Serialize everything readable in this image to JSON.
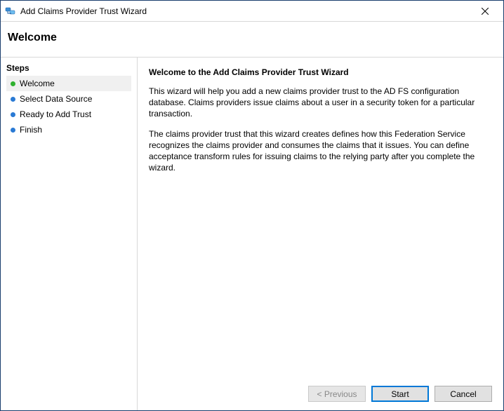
{
  "titlebar": {
    "title": "Add Claims Provider Trust Wizard"
  },
  "page_title": "Welcome",
  "sidebar": {
    "heading": "Steps",
    "items": [
      {
        "label": "Welcome",
        "active": true,
        "bullet": "green"
      },
      {
        "label": "Select Data Source",
        "active": false,
        "bullet": "blue"
      },
      {
        "label": "Ready to Add Trust",
        "active": false,
        "bullet": "blue"
      },
      {
        "label": "Finish",
        "active": false,
        "bullet": "blue"
      }
    ]
  },
  "main": {
    "heading": "Welcome to the Add Claims Provider Trust Wizard",
    "para1": "This wizard will help you add a new claims provider trust to the AD FS configuration database. Claims providers issue claims about a user in a security token for a particular transaction.",
    "para2": "The claims provider trust that this wizard creates defines how this Federation Service recognizes the claims provider and consumes the claims that it issues. You can define acceptance transform rules for issuing claims to the relying party after you complete the wizard."
  },
  "buttons": {
    "previous": "< Previous",
    "start": "Start",
    "cancel": "Cancel"
  }
}
